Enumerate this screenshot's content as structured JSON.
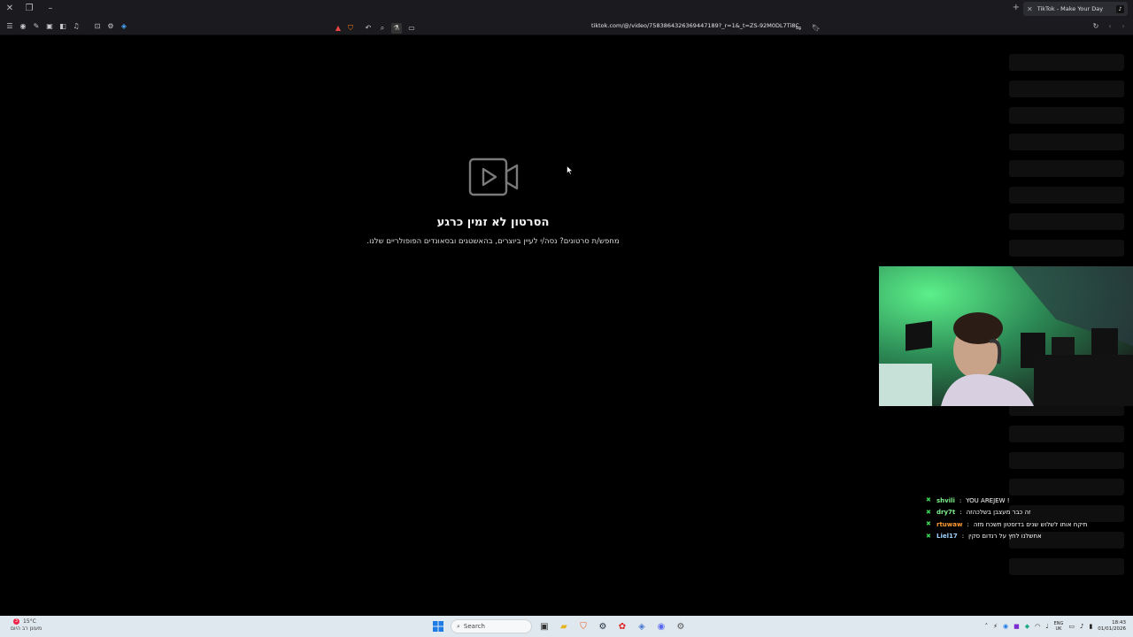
{
  "browser": {
    "tab_title": "TikTok - Make Your Day",
    "url": "tiktok.com/@/video/7583864326369447189?_r=1&_t=ZS-92M0DL7Ti8C",
    "new_tab_symbol": "+"
  },
  "main": {
    "title": "הסרטון לא זמין כרגע",
    "subtitle": "מחפש/ת סרטונים? נסה/י לעיין ביוצרים, בהאשטגים ובסאונדים הפופולריים שלנו."
  },
  "chat": [
    {
      "user": "shvili",
      "message": "YOU AREJEW !",
      "color": "#7cf08a"
    },
    {
      "user": "dry7t",
      "message": "זה כבר מעצבן בשלכהזה",
      "color": "#7cf08a"
    },
    {
      "user": "rtuwaw",
      "message": "תיקח אותו לשלוש שנים בדזסטון תשכח מזה",
      "color": "#ff9a2e"
    },
    {
      "user": "Liel17",
      "message": "אחשלנו לחץ על רנדום סקין",
      "color": "#9fd3ff"
    }
  ],
  "taskbar": {
    "weather_temp": "15°C",
    "weather_desc": "מעונן רב היום",
    "weather_badge": "3",
    "search_placeholder": "Search",
    "lang_top": "ENG",
    "lang_bottom": "UK",
    "time": "18:43",
    "date": "01/01/2026"
  },
  "colors": {
    "chrome_bg": "#1b1b1f",
    "page_bg": "#000000",
    "taskbar_bg": "#dfe8ef"
  }
}
